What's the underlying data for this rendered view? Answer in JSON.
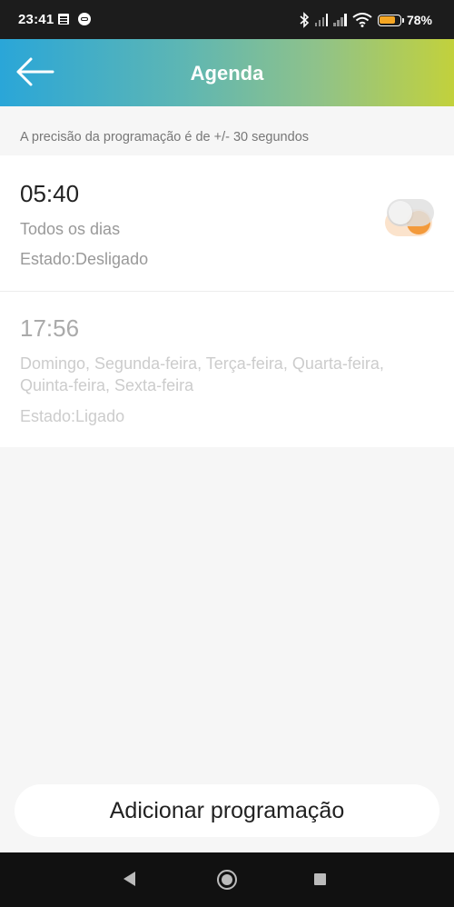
{
  "status_bar": {
    "time": "23:41",
    "battery_percent": "78%",
    "battery_level": 0.78,
    "icons": [
      "document-icon",
      "ring-icon",
      "bluetooth-icon",
      "signal-icon",
      "signal-icon",
      "wifi-icon",
      "battery-icon"
    ]
  },
  "header": {
    "title": "Agenda",
    "back_icon": "arrow-left-icon",
    "gradient": [
      "#2aa6d8",
      "#c2d13c"
    ]
  },
  "notice": "A precisão da programação é de +/- 30 segundos",
  "schedules": [
    {
      "time": "05:40",
      "days": "Todos os dias",
      "state": "Estado:Desligado",
      "toggle_on": true
    },
    {
      "time": "17:56",
      "days": "Domingo, Segunda-feira, Terça-feira, Quarta-feira, Quinta-feira, Sexta-feira",
      "state": "Estado:Ligado",
      "toggle_on": false
    }
  ],
  "add_button_label": "Adicionar programação",
  "colors": {
    "accent": "#f39a3b",
    "accent_light": "#fbe3cc"
  },
  "nav_bar": {
    "icons": [
      "nav-back-icon",
      "nav-home-icon",
      "nav-recents-icon"
    ]
  }
}
